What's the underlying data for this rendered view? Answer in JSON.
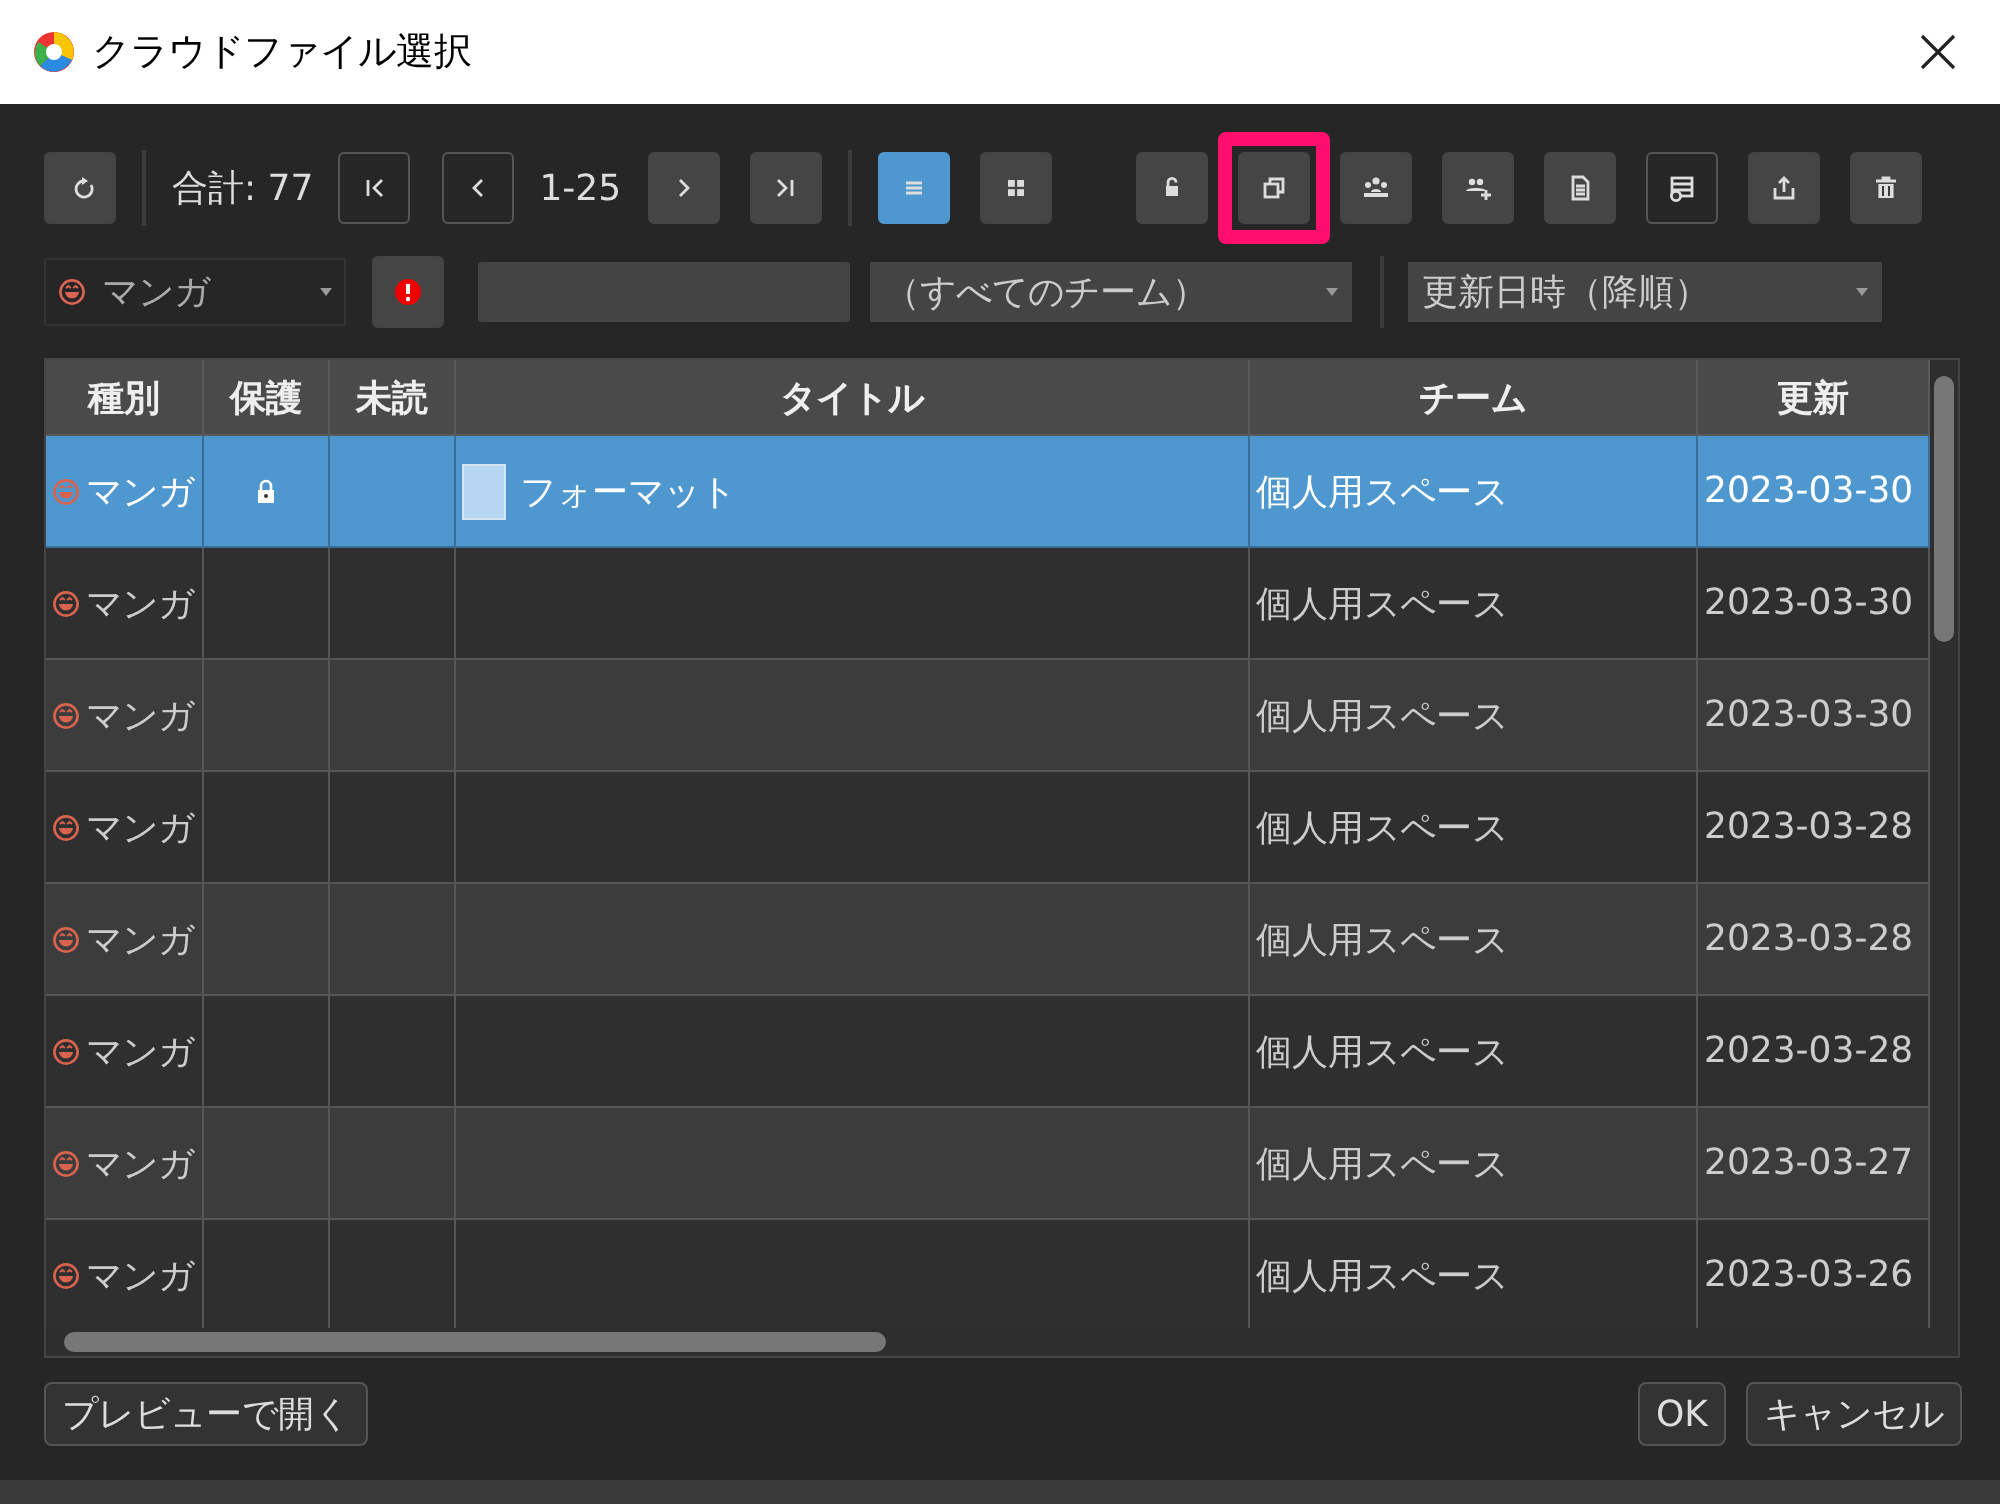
{
  "window": {
    "title": "クラウドファイル選択"
  },
  "toolbar": {
    "total": "合計: 77",
    "page_range": "1-25",
    "nav_buttons": [
      {
        "kind": "first",
        "disabled": true
      },
      {
        "kind": "prev",
        "disabled": true
      },
      {
        "kind": "next",
        "disabled": false
      },
      {
        "kind": "last",
        "disabled": false
      }
    ],
    "view_buttons": [
      {
        "kind": "list",
        "selected": true
      },
      {
        "kind": "grid",
        "selected": false
      }
    ],
    "action_buttons": [
      {
        "kind": "lock",
        "disabled": false,
        "highlighted": false
      },
      {
        "kind": "duplicate",
        "disabled": false,
        "highlighted": true
      },
      {
        "kind": "team",
        "disabled": false,
        "highlighted": false
      },
      {
        "kind": "team-add",
        "disabled": false,
        "highlighted": false
      },
      {
        "kind": "document",
        "disabled": false,
        "highlighted": false
      },
      {
        "kind": "table-history",
        "disabled": true,
        "highlighted": false
      },
      {
        "kind": "export",
        "disabled": false,
        "highlighted": false
      },
      {
        "kind": "trash",
        "disabled": false,
        "highlighted": false
      }
    ]
  },
  "filters": {
    "kind_dropdown": "マンガ",
    "team_dropdown": "（すべてのチーム）",
    "sort_dropdown": "更新日時（降順）"
  },
  "table": {
    "columns": [
      "種別",
      "保護",
      "未読",
      "タイトル",
      "チーム",
      "更新"
    ],
    "rows": [
      {
        "kind": "マンガ",
        "protected": true,
        "title": "フォーマット",
        "team": "個人用スペース",
        "updated": "2023-03-30",
        "selected": true
      },
      {
        "kind": "マンガ",
        "protected": false,
        "team": "個人用スペース",
        "updated": "2023-03-30",
        "selected": false
      },
      {
        "kind": "マンガ",
        "protected": false,
        "team": "個人用スペース",
        "updated": "2023-03-30",
        "selected": false
      },
      {
        "kind": "マンガ",
        "protected": false,
        "team": "個人用スペース",
        "updated": "2023-03-28",
        "selected": false
      },
      {
        "kind": "マンガ",
        "protected": false,
        "team": "個人用スペース",
        "updated": "2023-03-28",
        "selected": false
      },
      {
        "kind": "マンガ",
        "protected": false,
        "team": "個人用スペース",
        "updated": "2023-03-28",
        "selected": false
      },
      {
        "kind": "マンガ",
        "protected": false,
        "team": "個人用スペース",
        "updated": "2023-03-27",
        "selected": false
      },
      {
        "kind": "マンガ",
        "protected": false,
        "team": "個人用スペース",
        "updated": "2023-03-26",
        "selected": false
      }
    ]
  },
  "footer": {
    "preview_button": "プレビューで開く",
    "ok_button": "OK",
    "cancel_button": "キャンセル"
  }
}
